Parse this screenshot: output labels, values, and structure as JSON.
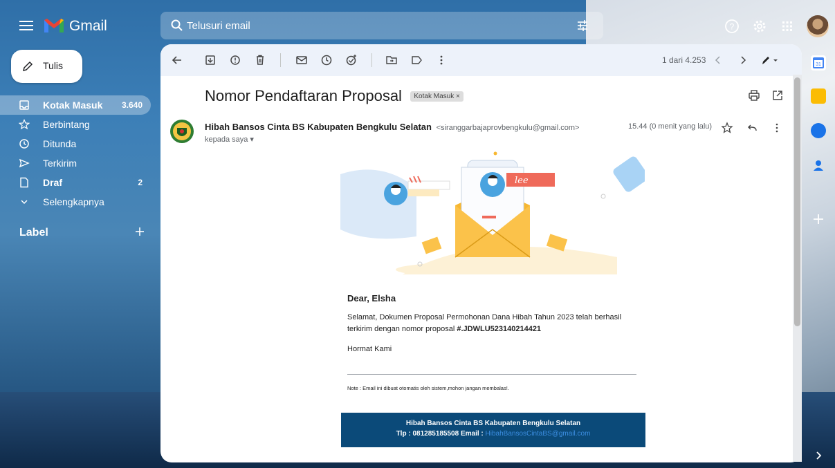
{
  "app": {
    "name": "Gmail"
  },
  "search": {
    "placeholder": "Telusuri email"
  },
  "compose": {
    "label": "Tulis"
  },
  "sidebar": {
    "items": [
      {
        "label": "Kotak Masuk",
        "count": "3.640",
        "icon": "inbox-icon"
      },
      {
        "label": "Berbintang",
        "count": "",
        "icon": "star-icon"
      },
      {
        "label": "Ditunda",
        "count": "",
        "icon": "clock-icon"
      },
      {
        "label": "Terkirim",
        "count": "",
        "icon": "send-icon"
      },
      {
        "label": "Draf",
        "count": "2",
        "icon": "draft-icon"
      },
      {
        "label": "Selengkapnya",
        "count": "",
        "icon": "chevron-down-icon"
      }
    ],
    "labels_heading": "Label"
  },
  "toolbar": {
    "pager": "1 dari 4.253"
  },
  "message": {
    "subject": "Nomor Pendaftaran Proposal",
    "tag": "Kotak Masuk ×",
    "sender_name": "Hibah Bansos Cinta BS Kabupaten Bengkulu Selatan",
    "sender_email": "<siranggarbajaprovbengkulu@gmail.com>",
    "recipient": "kepada saya ▾",
    "time": "15.44 (0 menit yang lalu)"
  },
  "body": {
    "greeting": "Dear, Elsha",
    "paragraph_1": "Selamat, Dokumen Proposal Permohonan Dana Hibah Tahun 2023 telah berhasil terkirim dengan nomor proposal ",
    "proposal_number": "#.JDWLU523140214421",
    "closing": "Hormat Kami",
    "note": "Note : Email ini dibuat otomatis oleh sistem,mohon jangan membalas!.",
    "footer_line1": "Hibah Bansos Cinta BS Kabupaten Bengkulu Selatan",
    "footer_line2_prefix": "Tlp : 081285185508 Email : ",
    "footer_email": "HibahBansosCintaBS@gmail.com"
  },
  "colors": {
    "accent": "#0b4a79",
    "active_nav": "rgba(255,255,255,0.32)"
  }
}
